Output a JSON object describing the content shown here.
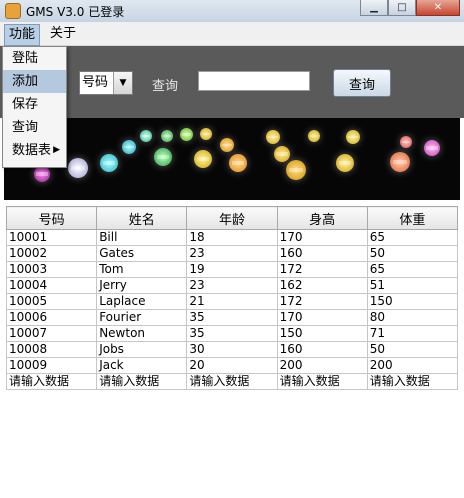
{
  "window": {
    "title": "GMS V3.0  已登录",
    "min_glyph": "▁",
    "max_glyph": "□",
    "close_glyph": "✕"
  },
  "menubar": [
    {
      "label": "功能"
    },
    {
      "label": "关于"
    }
  ],
  "dropdown": {
    "items": [
      {
        "label": "登陆"
      },
      {
        "label": "添加"
      },
      {
        "label": "保存"
      },
      {
        "label": "查询"
      },
      {
        "label": "数据表"
      }
    ],
    "submenu_arrow": "▶"
  },
  "toolbar": {
    "combo_value": "号码",
    "combo_arrow": "▼",
    "query_label": "查询",
    "search_value": "",
    "query_button": "查询"
  },
  "table": {
    "columns": [
      "号码",
      "姓名",
      "年龄",
      "身高",
      "体重"
    ],
    "rows": [
      [
        "10001",
        "Bill",
        "18",
        "170",
        "65"
      ],
      [
        "10002",
        "Gates",
        "23",
        "160",
        "50"
      ],
      [
        "10003",
        "Tom",
        "19",
        "172",
        "65"
      ],
      [
        "10004",
        "Jerry",
        "23",
        "162",
        "51"
      ],
      [
        "10005",
        "Laplace",
        "21",
        "172",
        "150"
      ],
      [
        "10006",
        "Fourier",
        "35",
        "170",
        "80"
      ],
      [
        "10007",
        "Newton",
        "35",
        "150",
        "71"
      ],
      [
        "10008",
        "Jobs",
        "30",
        "160",
        "50"
      ],
      [
        "10009",
        "Jack",
        "20",
        "200",
        "200"
      ],
      [
        "请输入数据",
        "请输入数据",
        "请输入数据",
        "请输入数据",
        "请输入数据"
      ]
    ]
  },
  "colors": {
    "toolbar_bg": "#5a5a5a",
    "banner_bg": "#060606",
    "menu_highlight": "#b4c8de"
  }
}
